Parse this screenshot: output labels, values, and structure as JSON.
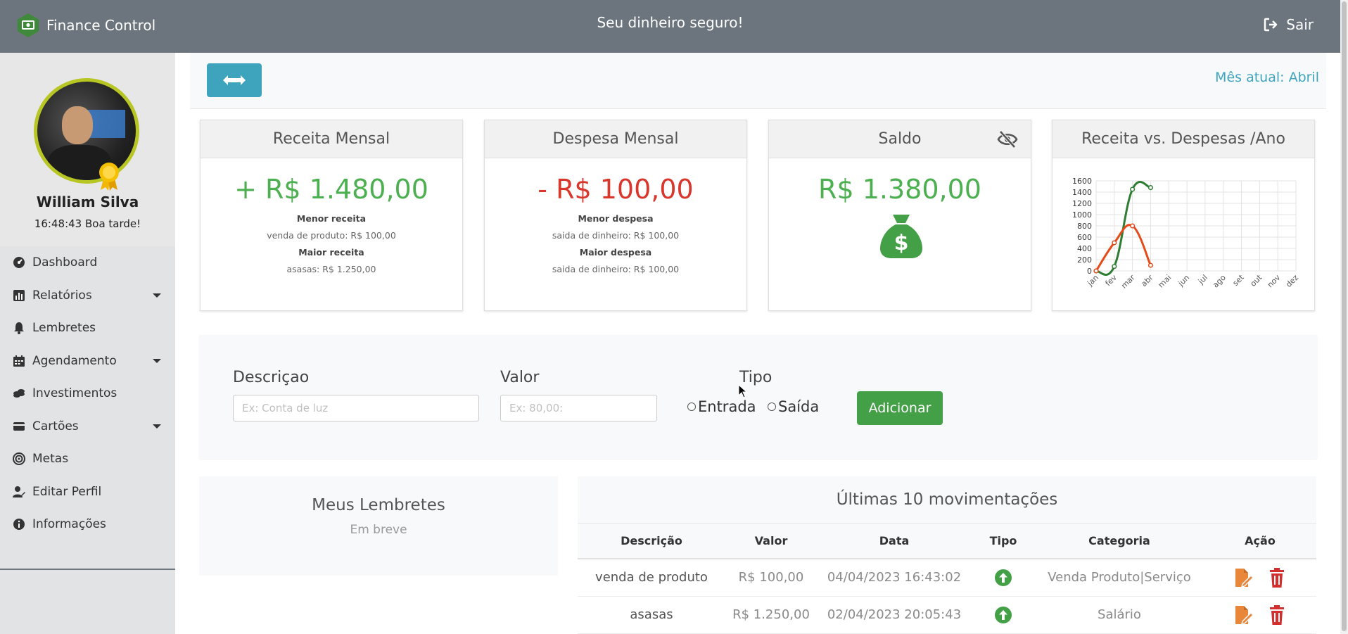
{
  "header": {
    "brand": "Finance Control",
    "slogan": "Seu dinheiro seguro!",
    "logout_label": "Sair"
  },
  "profile": {
    "name": "William Silva",
    "greeting": "16:48:43 Boa tarde!"
  },
  "sidebar": {
    "items": [
      {
        "label": "Dashboard",
        "icon": "dashboard-icon"
      },
      {
        "label": "Relatórios",
        "icon": "chart-bar-icon",
        "dropdown": true
      },
      {
        "label": "Lembretes",
        "icon": "bell-icon"
      },
      {
        "label": "Agendamento",
        "icon": "calendar-icon",
        "dropdown": true
      },
      {
        "label": "Investimentos",
        "icon": "coins-icon"
      },
      {
        "label": "Cartões",
        "icon": "credit-card-icon",
        "dropdown": true
      },
      {
        "label": "Metas",
        "icon": "target-icon"
      },
      {
        "label": "Editar Perfil",
        "icon": "user-edit-icon"
      },
      {
        "label": "Informações",
        "icon": "info-icon"
      }
    ]
  },
  "topbar": {
    "mes_atual": "Mês atual: Abril"
  },
  "cards": {
    "receita": {
      "title": "Receita Mensal",
      "value": "+ R$ 1.480,00",
      "menor_label": "Menor receita",
      "menor_value": "venda de produto: R$ 100,00",
      "maior_label": "Maior receita",
      "maior_value": "asasas: R$ 1.250,00"
    },
    "despesa": {
      "title": "Despesa Mensal",
      "value": "- R$ 100,00",
      "menor_label": "Menor despesa",
      "menor_value": "saida de dinheiro: R$ 100,00",
      "maior_label": "Maior despesa",
      "maior_value": "saida de dinheiro: R$ 100,00"
    },
    "saldo": {
      "title": "Saldo",
      "value": "R$ 1.380,00"
    },
    "grafico": {
      "title": "Receita vs. Despesas /Ano"
    }
  },
  "chart_data": {
    "type": "line",
    "categories": [
      "jan",
      "fev",
      "mar",
      "abr",
      "mai",
      "jun",
      "jul",
      "ago",
      "set",
      "out",
      "nov",
      "dez"
    ],
    "series": [
      {
        "values": [
          0,
          80,
          1450,
          1480
        ],
        "color": "#2e7d32"
      },
      {
        "values": [
          0,
          500,
          800,
          100
        ],
        "color": "#e64a19"
      }
    ],
    "yticks": [
      0,
      200,
      400,
      600,
      800,
      1000,
      1200,
      1400,
      1600
    ],
    "ylim": [
      0,
      1600
    ],
    "grid": true
  },
  "form": {
    "descricao_label": "Descriçao",
    "descricao_placeholder": "Ex: Conta de luz",
    "valor_label": "Valor",
    "valor_placeholder": "Ex: 80,00:",
    "tipo_label": "Tipo",
    "entrada_label": "Entrada",
    "saida_label": "Saída",
    "submit_label": "Adicionar"
  },
  "lembretes": {
    "title": "Meus Lembretes",
    "subtitle": "Em breve"
  },
  "movimentacoes": {
    "title": "Últimas 10 movimentações",
    "columns": [
      "Descrição",
      "Valor",
      "Data",
      "Tipo",
      "Categoria",
      "Ação"
    ],
    "rows": [
      {
        "descricao": "venda de produto",
        "valor": "R$ 100,00",
        "data": "04/04/2023 16:43:02",
        "tipo": "entrada",
        "categoria": "Venda Produto|Serviço"
      },
      {
        "descricao": "asasas",
        "valor": "R$ 1.250,00",
        "data": "02/04/2023 20:05:43",
        "tipo": "entrada",
        "categoria": "Salário"
      }
    ]
  },
  "colors": {
    "header": "#6c757d",
    "accent": "#3ea3bd",
    "positive": "#4caf50",
    "negative": "#d9362c",
    "button_green": "#43a047",
    "edit_icon": "#e8863a",
    "delete_icon": "#d32f2f"
  }
}
